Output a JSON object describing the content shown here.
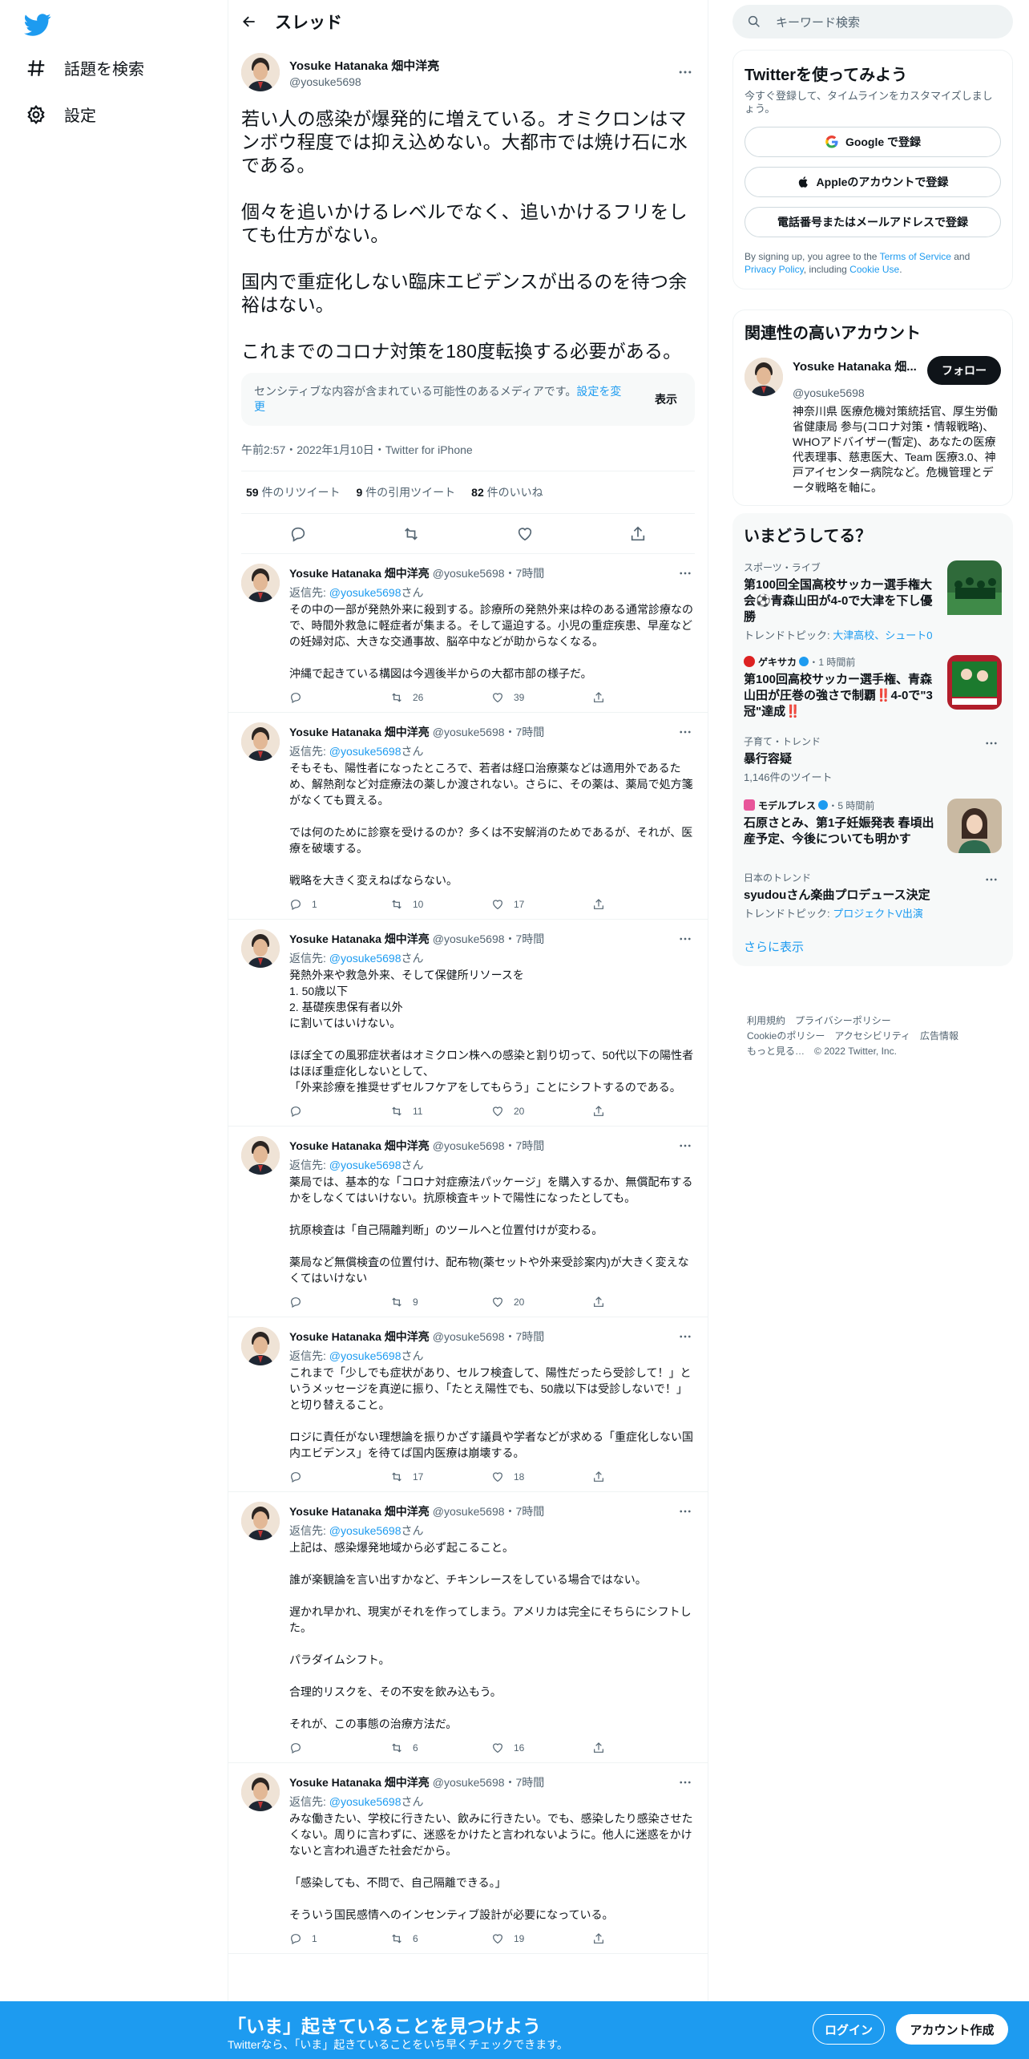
{
  "nav": {
    "explore": "話題を検索",
    "settings": "設定"
  },
  "header": {
    "title": "スレッド"
  },
  "focus": {
    "name": "Yosuke Hatanaka 畑中洋亮",
    "handle": "@yosuke5698",
    "text": "若い人の感染が爆発的に増えている。オミクロンはマンボウ程度では抑え込めない。大都市では焼け石に水である。\n\n個々を追いかけるレベルでなく、追いかけるフリをしても仕方がない。\n\n国内で重症化しない臨床エビデンスが出るのを待つ余裕はない。\n\nこれまでのコロナ対策を180度転換する必要がある。",
    "sensitive_msg": "センシティブな内容が含まれている可能性のあるメディアです。",
    "sensitive_link": "設定を変更",
    "sensitive_show": "表示",
    "meta": "午前2:57・2022年1月10日・Twitter for iPhone",
    "retweets": "59",
    "retweets_label": "件のリツイート",
    "quotes": "9",
    "quotes_label": "件の引用ツイート",
    "likes": "82",
    "likes_label": "件のいいね"
  },
  "replies": [
    {
      "name": "Yosuke Hatanaka 畑中洋亮",
      "handle": "@yosuke5698・7時間",
      "replyto_prefix": "返信先: ",
      "replyto": "@yosuke5698",
      "replyto_suffix": "さん",
      "text": "その中の一部が発熱外来に殺到する。診療所の発熱外来は枠のある通常診療なので、時間外救急に軽症者が集まる。そして逼迫する。小児の重症疾患、早産などの妊婦対応、大きな交通事故、脳卒中などが助からなくなる。\n\n沖縄で起きている構図は今週後半からの大都市部の様子だ。",
      "replies": "",
      "retweets": "26",
      "likes": "39"
    },
    {
      "name": "Yosuke Hatanaka 畑中洋亮",
      "handle": "@yosuke5698・7時間",
      "replyto_prefix": "返信先: ",
      "replyto": "@yosuke5698",
      "replyto_suffix": "さん",
      "text": "そもそも、陽性者になったところで、若者は経口治療薬などは適用外であるため、解熱剤など対症療法の薬しか渡されない。さらに、その薬は、薬局で処方箋がなくても買える。\n\nでは何のために診察を受けるのか？多くは不安解消のためであるが、それが、医療を破壊する。\n\n戦略を大きく変えねばならない。",
      "replies": "1",
      "retweets": "10",
      "likes": "17"
    },
    {
      "name": "Yosuke Hatanaka 畑中洋亮",
      "handle": "@yosuke5698・7時間",
      "replyto_prefix": "返信先: ",
      "replyto": "@yosuke5698",
      "replyto_suffix": "さん",
      "text": "発熱外来や救急外来、そして保健所リソースを\n1. 50歳以下\n2. 基礎疾患保有者以外\nに割いてはいけない。\n\nほぼ全ての風邪症状者はオミクロン株への感染と割り切って、50代以下の陽性者はほぼ重症化しないとして、\n「外来診療を推奨せずセルフケアをしてもらう」ことにシフトするのである。",
      "replies": "",
      "retweets": "11",
      "likes": "20"
    },
    {
      "name": "Yosuke Hatanaka 畑中洋亮",
      "handle": "@yosuke5698・7時間",
      "replyto_prefix": "返信先: ",
      "replyto": "@yosuke5698",
      "replyto_suffix": "さん",
      "text": "薬局では、基本的な「コロナ対症療法パッケージ」を購入するか、無償配布するかをしなくてはいけない。抗原検査キットで陽性になったとしても。\n\n抗原検査は「自己隔離判断」のツールへと位置付けが変わる。\n\n薬局など無償検査の位置付け、配布物(薬セットや外来受診案内)が大きく変えなくてはいけない",
      "replies": "",
      "retweets": "9",
      "likes": "20"
    },
    {
      "name": "Yosuke Hatanaka 畑中洋亮",
      "handle": "@yosuke5698・7時間",
      "replyto_prefix": "返信先: ",
      "replyto": "@yosuke5698",
      "replyto_suffix": "さん",
      "text": "これまで「少しでも症状があり、セルフ検査して、陽性だったら受診して！」というメッセージを真逆に振り、「たとえ陽性でも、50歳以下は受診しないで！」と切り替えること。\n\nロジに責任がない理想論を振りかざす議員や学者などが求める「重症化しない国内エビデンス」を待てば国内医療は崩壊する。",
      "replies": "",
      "retweets": "17",
      "likes": "18"
    },
    {
      "name": "Yosuke Hatanaka 畑中洋亮",
      "handle": "@yosuke5698・7時間",
      "replyto_prefix": "返信先: ",
      "replyto": "@yosuke5698",
      "replyto_suffix": "さん",
      "text": "上記は、感染爆発地域から必ず起こること。\n\n誰が楽観論を言い出すかなど、チキンレースをしている場合ではない。\n\n遅かれ早かれ、現実がそれを作ってしまう。アメリカは完全にそちらにシフトした。\n\nパラダイムシフト。\n\n合理的リスクを、その不安を飲み込もう。\n\nそれが、この事態の治療方法だ。",
      "replies": "",
      "retweets": "6",
      "likes": "16"
    },
    {
      "name": "Yosuke Hatanaka 畑中洋亮",
      "handle": "@yosuke5698・7時間",
      "replyto_prefix": "返信先: ",
      "replyto": "@yosuke5698",
      "replyto_suffix": "さん",
      "text": "みな働きたい、学校に行きたい、飲みに行きたい。でも、感染したり感染させたくない。周りに言わずに、迷惑をかけたと言われないように。他人に迷惑をかけないと言われ過ぎた社会だから。\n\n「感染しても、不問で、自己隔離できる。」\n\nそういう国民感情へのインセンティブ設計が必要になっている。",
      "replies": "1",
      "retweets": "6",
      "likes": "19"
    }
  ],
  "search": {
    "placeholder": "キーワード検索"
  },
  "signup": {
    "title": "Twitterを使ってみよう",
    "sub": "今すぐ登録して、タイムラインをカスタマイズしましょう。",
    "google": "Google で登録",
    "apple": "Appleのアカウントで登録",
    "phone": "電話番号またはメールアドレスで登録",
    "terms_a": "By signing up, you agree to the ",
    "terms_tos": "Terms of Service",
    "terms_b": " and ",
    "terms_pp": "Privacy Policy",
    "terms_c": ", including ",
    "terms_cookie": "Cookie Use",
    "terms_d": "."
  },
  "related": {
    "title": "関連性の高いアカウント",
    "name": "Yosuke Hatanaka 畑...",
    "handle": "@yosuke5698",
    "follow": "フォロー",
    "bio": "神奈川県 医療危機対策統括官、厚生労働省健康局 参与(コロナ対策・情報戦略)、WHOアドバイザー(暫定)、あなたの医療 代表理事、慈恵医大、Team 医療3.0、神戸アイセンター病院など。危機管理とデータ戦略を軸に。"
  },
  "trends": {
    "title": "いまどうしてる？",
    "items": [
      {
        "meta": "スポーツ・ライブ",
        "title": "第100回全国高校サッカー選手権大会⚽青森山田が4-0で大津を下し優勝",
        "sub_label": "トレンドトピック: ",
        "sub_link": "大津高校、シュート0"
      },
      {
        "meta_src": "ゲキサカ",
        "meta_time": "・1 時間前",
        "title": "第100回高校サッカー選手権、青森山田が圧巻の強さで制覇‼️4-0で\"3冠\"達成‼️",
        "sub_label": "",
        "sub_link": ""
      },
      {
        "meta": "子育て・トレンド",
        "title": "暴行容疑",
        "sub_label": "1,146件のツイート",
        "sub_link": ""
      },
      {
        "meta_src": "モデルプレス",
        "meta_time": "・5 時間前",
        "title": "石原さとみ、第1子妊娠発表 春頃出産予定、今後についても明かす",
        "sub_label": "",
        "sub_link": ""
      },
      {
        "meta": "日本のトレンド",
        "title": "syudouさん楽曲プロデュース決定",
        "sub_label": "トレンドトピック: ",
        "sub_link": "プロジェクトV出演"
      }
    ],
    "show_more": "さらに表示"
  },
  "footer": {
    "links": [
      "利用規約",
      "プライバシーポリシー",
      "Cookieのポリシー",
      "アクセシビリティ",
      "広告情報",
      "もっと見る…"
    ],
    "copyright": "© 2022 Twitter, Inc."
  },
  "bottom": {
    "title": "「いま」起きていることを見つけよう",
    "sub": "Twitterなら、「いま」起きていることをいち早くチェックできます。",
    "login": "ログイン",
    "signup": "アカウント作成"
  },
  "colors": {
    "accent": "#1d9bf0",
    "text": "#0f1419",
    "muted": "#536471"
  }
}
